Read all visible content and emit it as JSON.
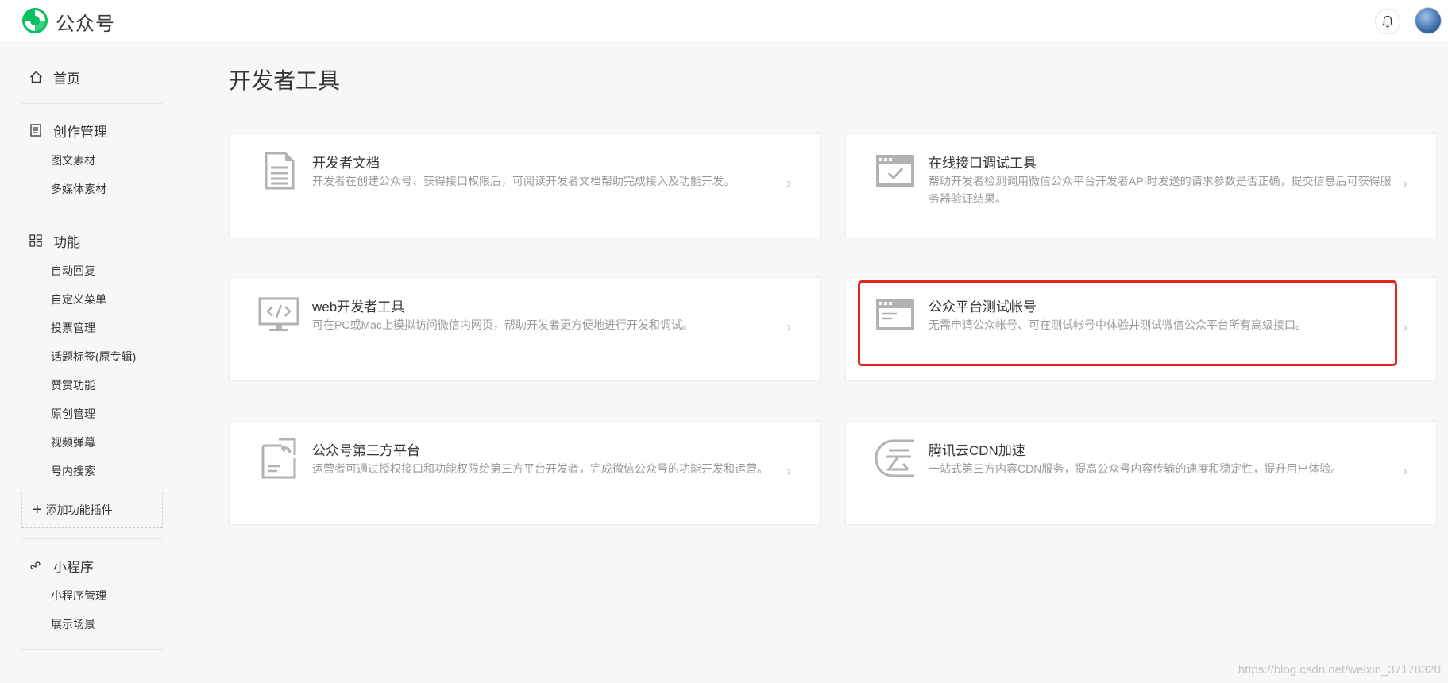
{
  "header": {
    "brand": "公众号"
  },
  "sidebar": {
    "home": "首页",
    "groups": [
      {
        "title": "创作管理",
        "items": [
          "图文素材",
          "多媒体素材"
        ]
      },
      {
        "title": "功能",
        "items": [
          "自动回复",
          "自定义菜单",
          "投票管理",
          "话题标签(原专辑)",
          "赞赏功能",
          "原创管理",
          "视频弹幕",
          "号内搜索"
        ]
      },
      {
        "title": "小程序",
        "items": [
          "小程序管理",
          "展示场景"
        ]
      }
    ],
    "add_plugin": "添加功能插件"
  },
  "main": {
    "title": "开发者工具",
    "cards": [
      {
        "title": "开发者文档",
        "desc": "开发者在创建公众号、获得接口权限后，可阅读开发者文档帮助完成接入及功能开发。",
        "icon": "document-icon"
      },
      {
        "title": "在线接口调试工具",
        "desc": "帮助开发者检测调用微信公众平台开发者API时发送的请求参数是否正确，提交信息后可获得服务器验证结果。",
        "icon": "debug-window-icon"
      },
      {
        "title": "web开发者工具",
        "desc": "可在PC或Mac上模拟访问微信内网页，帮助开发者更方便地进行开发和调试。",
        "icon": "monitor-code-icon"
      },
      {
        "title": "公众平台测试帐号",
        "desc": "无需申请公众帐号、可在测试帐号中体验并测试微信公众平台所有高级接口。",
        "icon": "test-window-icon"
      },
      {
        "title": "公众号第三方平台",
        "desc": "运营者可通过授权接口和功能权限给第三方平台开发者，完成微信公众号的功能开发和运营。",
        "icon": "authorize-document-icon"
      },
      {
        "title": "腾讯云CDN加速",
        "desc": "一站式第三方内容CDN服务，提高公众号内容传输的速度和稳定性，提升用户体验。",
        "icon": "tencent-cloud-icon"
      }
    ],
    "arrow": "›"
  },
  "watermark": "https://blog.csdn.net/weixin_37178320",
  "colors": {
    "highlight": "#e5231f",
    "brand_green": "#07c160"
  }
}
